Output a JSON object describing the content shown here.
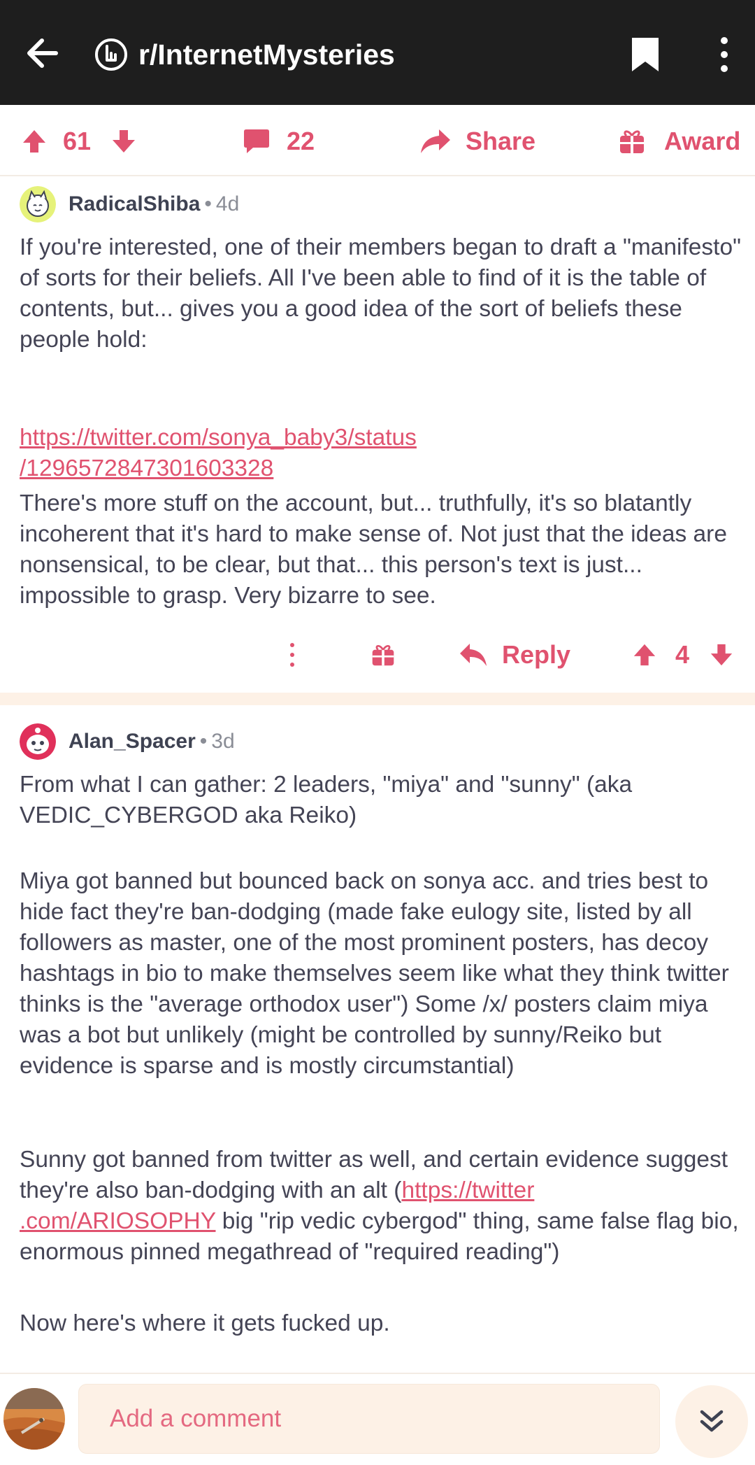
{
  "header": {
    "subreddit": "r/InternetMysteries"
  },
  "post_actions": {
    "upvotes": "61",
    "comments": "22",
    "share_label": "Share",
    "award_label": "Award"
  },
  "comments": [
    {
      "author": "RadicalShiba",
      "separator": "•",
      "age": "4d",
      "paragraphs": [
        "If you're interested, one of their members began to draft a \"manifesto\" of sorts for their beliefs. All I've been able to find of it is the table of contents, but... gives you a good idea of the sort of beliefs these people hold:",
        "There's more stuff on the account, but... truthfully, it's so blatantly incoherent that it's hard to make sense of. Not just that the ideas are nonsensical, to be clear, but that... this person's text is just... impossible to grasp. Very bizarre to see."
      ],
      "link": "https://twitter.com/sonya_baby3/status\n/1296572847301603328",
      "reply_label": "Reply",
      "score": "4"
    },
    {
      "author": "Alan_Spacer",
      "separator": "•",
      "age": "3d",
      "paragraphs": [
        "From what I can gather: 2 leaders, \"miya\" and \"sunny\" (aka VEDIC_CYBERGOD aka Reiko)",
        "Miya got banned but bounced back on sonya acc. and tries best to hide fact they're ban-dodging (made fake eulogy site, listed by all followers as master, one of the most prominent posters, has decoy hashtags in bio to make themselves seem like what they think twitter thinks is the \"average orthodox user\") Some /x/ posters claim miya was a bot but unlikely (might be controlled by sunny/Reiko but evidence is sparse and is mostly circumstantial)",
        "Sunny got banned from twitter as well, and certain evidence suggest they're also ban-dodging with an alt (",
        " big \"rip vedic cybergod\" thing, same false flag bio, enormous pinned megathread of \"required reading\")",
        "Now here's where it gets fucked up."
      ],
      "link": "https://twitter\n.com/ARIOSOPHY"
    }
  ],
  "composer": {
    "placeholder": "Add a comment"
  },
  "colors": {
    "accent": "#e0526f",
    "top_bar": "#1e1e1e",
    "divider": "#fdf1e6",
    "text": "#444455"
  },
  "icons": {
    "back": "arrow-left-icon",
    "subreddit": "subreddit-icon",
    "bookmark": "bookmark-icon",
    "more": "more-vertical-icon",
    "upvote": "upvote-arrow-icon",
    "downvote": "downvote-arrow-icon",
    "comment": "comment-bubble-icon",
    "share": "share-arrow-icon",
    "award": "gift-icon",
    "reply": "reply-arrow-icon",
    "jump": "double-chevron-down-icon"
  }
}
